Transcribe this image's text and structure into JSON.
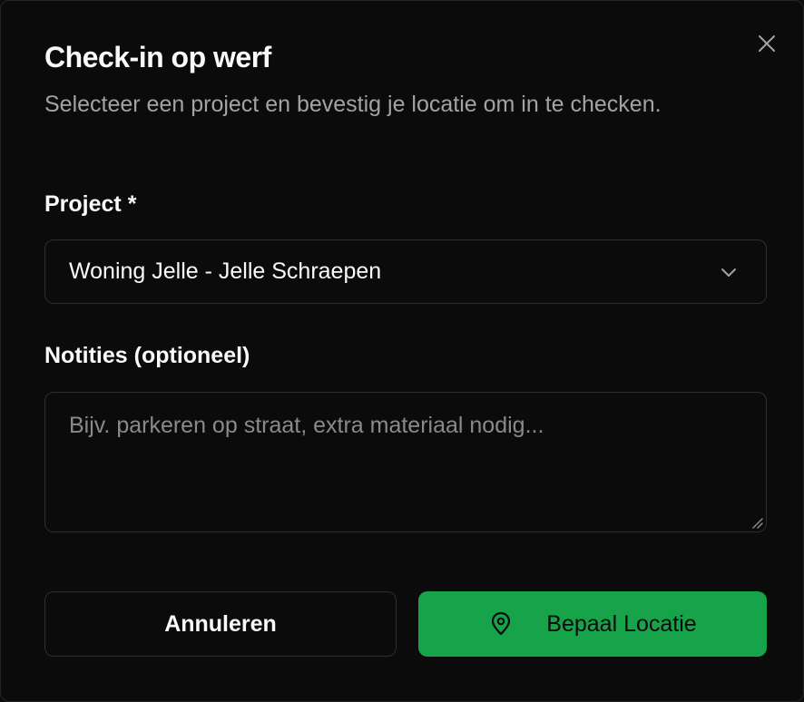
{
  "dialog": {
    "title": "Check-in op werf",
    "subtitle": "Selecteer een project en bevestig je locatie om in te checken.",
    "close_icon": "x-icon"
  },
  "project": {
    "label": "Project *",
    "selected_value": "Woning Jelle - Jelle Schraepen",
    "icon": "chevron-down-icon"
  },
  "notes": {
    "label": "Notities (optioneel)",
    "value": "",
    "placeholder": "Bijv. parkeren op straat, extra materiaal nodig..."
  },
  "actions": {
    "cancel_label": "Annuleren",
    "primary_label": "Bepaal Locatie",
    "primary_icon": "map-pin-icon"
  },
  "colors": {
    "background": "#0b0b0b",
    "border": "#2e2e2e",
    "text": "#fafafa",
    "muted_text": "#a3a3a3",
    "accent": "#16a34a"
  }
}
